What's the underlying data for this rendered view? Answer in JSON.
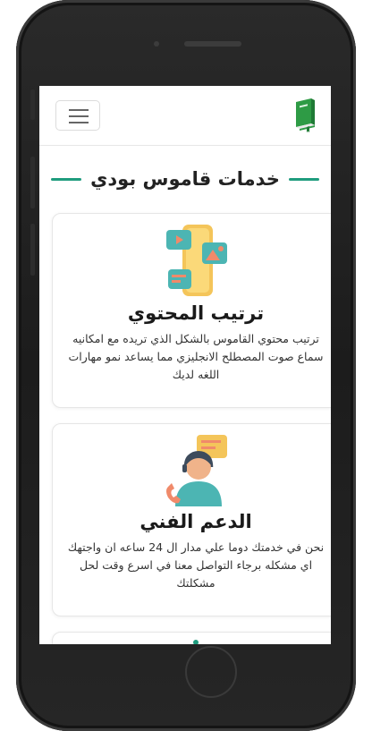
{
  "navbar": {
    "logo_icon": "green-book-icon",
    "menu_icon": "hamburger-icon"
  },
  "section": {
    "title": "خدمات قاموس بودي"
  },
  "services": [
    {
      "icon": "phone-media-icon",
      "title": "ترتيب المحتوي",
      "description": "ترتيب محتوي القاموس بالشكل الذي تريده مع امكانيه سماع صوت المصطلح الانجليزي مما يساعد نمو مهارات اللغه لديك"
    },
    {
      "icon": "support-agent-icon",
      "title": "الدعم الفني",
      "description": "نحن في خدمتك دوما علي مدار ال 24 ساعه ان واجتهك اي مشكله برجاء التواصل معنا في اسرع وقت لحل مشكلتك"
    }
  ],
  "colors": {
    "accent": "#1f9c7e",
    "logo_green": "#2e9b45"
  }
}
